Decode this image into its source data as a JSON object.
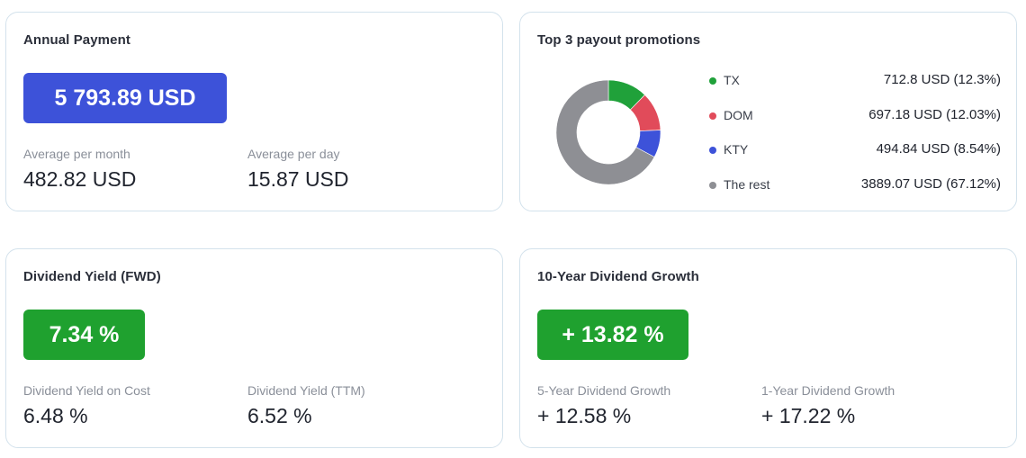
{
  "annual": {
    "title": "Annual Payment",
    "hero": "5 793.89 USD",
    "month_label": "Average per month",
    "month_value": "482.82 USD",
    "day_label": "Average per day",
    "day_value": "15.87 USD"
  },
  "promotions": {
    "title": "Top 3 payout promotions",
    "items": [
      {
        "name": "TX",
        "value": "712.8 USD (12.3%)",
        "percent": 12.3,
        "color": "#20a13a"
      },
      {
        "name": "DOM",
        "value": "697.18 USD (12.03%)",
        "percent": 12.03,
        "color": "#e14b5a"
      },
      {
        "name": "KTY",
        "value": "494.84 USD (8.54%)",
        "percent": 8.54,
        "color": "#3d52d9"
      },
      {
        "name": "The rest",
        "value": "3889.07 USD (67.12%)",
        "percent": 67.12,
        "color": "#8e8f94"
      }
    ]
  },
  "yield": {
    "title": "Dividend Yield (FWD)",
    "hero": "7.34 %",
    "cost_label": "Dividend Yield on Cost",
    "cost_value": "6.48 %",
    "ttm_label": "Dividend Yield (TTM)",
    "ttm_value": "6.52 %"
  },
  "growth": {
    "title": "10-Year Dividend Growth",
    "hero": "+ 13.82 %",
    "five_label": "5-Year Dividend Growth",
    "five_value": "+ 12.58 %",
    "one_label": "1-Year Dividend Growth",
    "one_value": "+ 17.22 %"
  },
  "colors": {
    "accent_blue": "#3d52d9",
    "accent_green": "#1fa12f",
    "card_border": "#d3e2ec"
  }
}
